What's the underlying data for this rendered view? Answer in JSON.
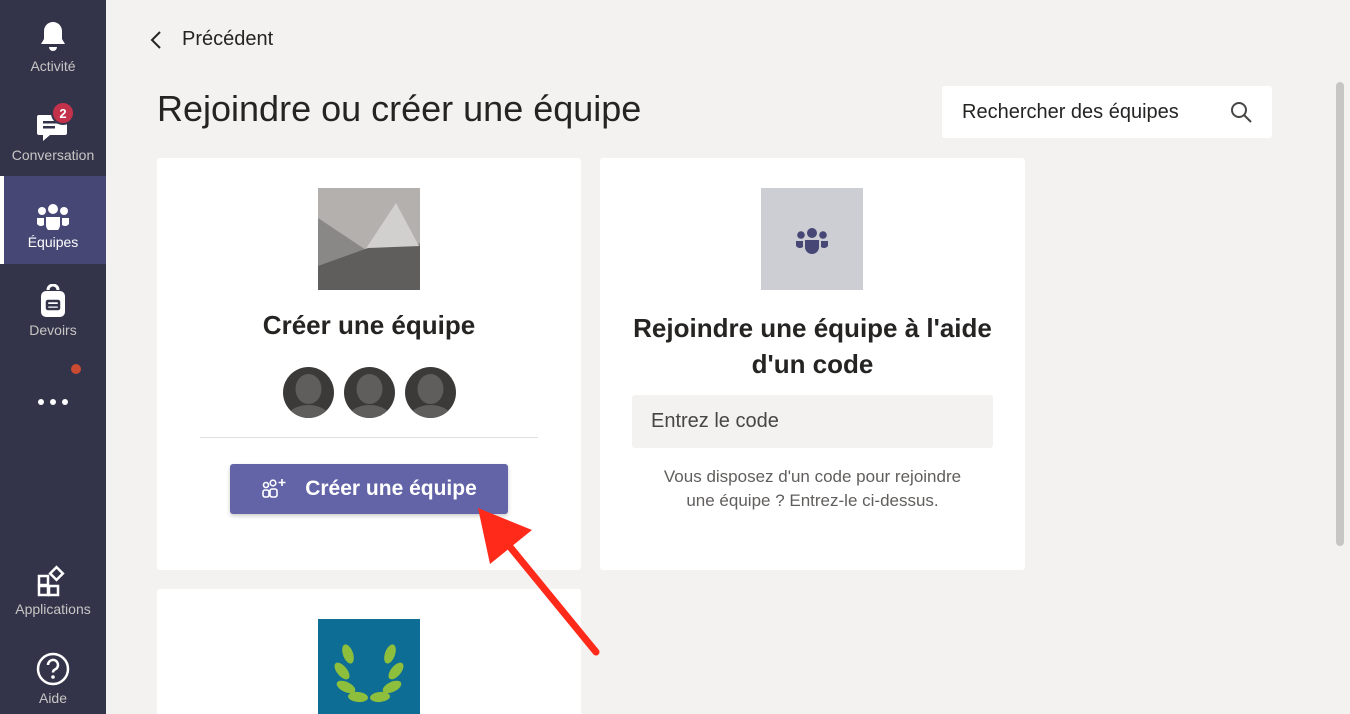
{
  "rail": {
    "items": [
      {
        "label": "Activité",
        "icon": "bell-icon"
      },
      {
        "label": "Conversation",
        "icon": "chat-icon",
        "badge": "2"
      },
      {
        "label": "Équipes",
        "icon": "teams-icon",
        "active": true
      },
      {
        "label": "Devoirs",
        "icon": "backpack-icon"
      },
      {
        "label": "",
        "icon": "more-icon"
      },
      {
        "label": "Applications",
        "icon": "apps-icon"
      },
      {
        "label": "Aide",
        "icon": "help-icon"
      }
    ]
  },
  "header": {
    "back_label": "Précédent",
    "title": "Rejoindre ou créer une équipe",
    "search_placeholder": "Rechercher des équipes"
  },
  "create_card": {
    "title": "Créer une équipe",
    "button_label": "Créer une équipe"
  },
  "join_card": {
    "title_line1": "Rejoindre une équipe à l'aide",
    "title_line2": "d'un code",
    "input_placeholder": "Entrez le code",
    "hint_line1": "Vous disposez d'un code pour rejoindre",
    "hint_line2": "une équipe ? Entrez-le ci-dessus."
  },
  "colors": {
    "rail_bg": "#33344a",
    "accent": "#6264a7",
    "badge": "#c4314b",
    "annotation_arrow": "#ff2a1a"
  }
}
